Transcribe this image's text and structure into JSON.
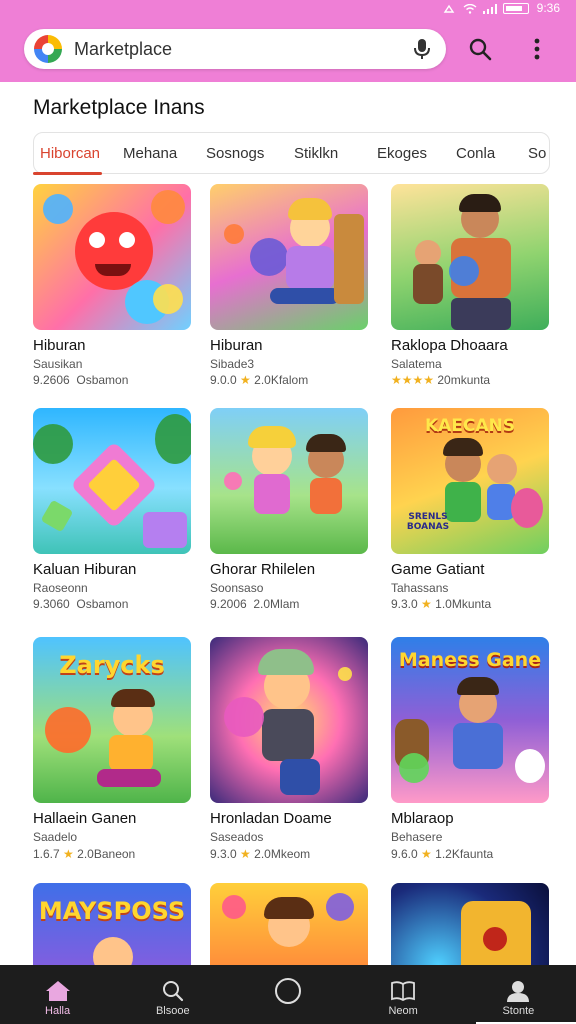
{
  "status_bar": {
    "time": "9:36"
  },
  "search": {
    "placeholder": "Marketplace"
  },
  "page": {
    "heading": "Marketplace Inans"
  },
  "tabs": [
    {
      "label": "Hiborcan",
      "active": true
    },
    {
      "label": "Mehana"
    },
    {
      "label": "Sosnogs"
    },
    {
      "label": "Stiklkn"
    },
    {
      "label": "Ekoges"
    },
    {
      "label": "Conla"
    },
    {
      "label": "So"
    }
  ],
  "cards": [
    {
      "title": "Hiburan",
      "sub": "Sausikan",
      "meta_a": "9.2606",
      "meta_b": "Osbamon",
      "rated": false
    },
    {
      "title": "Hiburan",
      "sub": "Sibade3",
      "meta_a": "9.0.0",
      "meta_b": "2.0Kfalom",
      "rated": true
    },
    {
      "title": "Raklopa Dhoaara",
      "sub": "Salatema",
      "meta_a": "★★★★",
      "meta_b": "20mkunta",
      "rated": false,
      "stars_only": true
    },
    {
      "title": "Kaluan Hiburan",
      "sub": "Raoseonn",
      "meta_a": "9.3060",
      "meta_b": "Osbamon",
      "rated": false
    },
    {
      "title": "Ghorar Rhilelen",
      "sub": "Soonsaso",
      "meta_a": "9.2006",
      "meta_b": "2.0Mlam",
      "rated": false
    },
    {
      "title": "Game Gatiant",
      "sub": "Tahassans",
      "meta_a": "9.3.0",
      "meta_b": "1.0Mkunta",
      "rated": true
    },
    {
      "title": "Hallaein Ganen",
      "sub": "Saadelo",
      "meta_a": "1.6.7",
      "meta_b": "2.0Baneon",
      "rated": true
    },
    {
      "title": "Hronladan Doame",
      "sub": "Saseados",
      "meta_a": "9.3.0",
      "meta_b": "2.0Mkeom",
      "rated": true
    },
    {
      "title": "Mblaraop",
      "sub": "Behasere",
      "meta_a": "9.6.0",
      "meta_b": "1.2Kfaunta",
      "rated": true
    },
    {
      "title": "",
      "sub": "",
      "meta_a": "",
      "meta_b": "",
      "banner": "Maysposs"
    },
    {
      "title": "",
      "sub": "",
      "meta_a": "",
      "meta_b": ""
    },
    {
      "title": "",
      "sub": "",
      "meta_a": "",
      "meta_b": ""
    }
  ],
  "thumb_text": {
    "c6": "KAECANS",
    "c6b": "SRENLS\nBOANAS",
    "c7": "Zarycks",
    "c9": "Maness Gane",
    "c10": "MAYSPOSS"
  },
  "nav": [
    {
      "label": "Halla",
      "icon": "home-icon",
      "active": true
    },
    {
      "label": "Blsooe",
      "icon": "search-icon"
    },
    {
      "label": "",
      "icon": "compass-icon"
    },
    {
      "label": "Neom",
      "icon": "book-icon"
    },
    {
      "label": "Stonte",
      "icon": "person-icon"
    }
  ],
  "colors": {
    "topbar": "#ef7fd6",
    "accent": "#d9442f",
    "navbar": "#1d1d1d",
    "star": "#f1b11f"
  }
}
